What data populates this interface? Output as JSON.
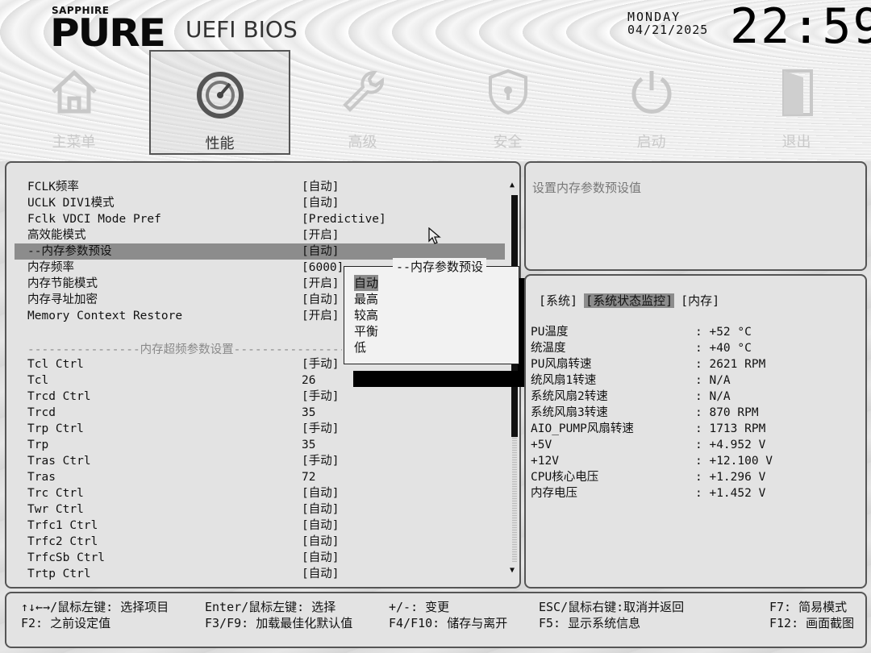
{
  "brand": {
    "small": "SAPPHIRE",
    "big": "PURE",
    "sub": "UEFI BIOS"
  },
  "clock": {
    "day": "MONDAY",
    "date": "04/21/2025",
    "time": "22:59"
  },
  "tabs": [
    {
      "label": "主菜单",
      "icon": "home-icon"
    },
    {
      "label": "性能",
      "icon": "gauge-icon"
    },
    {
      "label": "高级",
      "icon": "wrench-icon"
    },
    {
      "label": "安全",
      "icon": "shield-lock-icon"
    },
    {
      "label": "启动",
      "icon": "power-icon"
    },
    {
      "label": "退出",
      "icon": "exit-door-icon"
    }
  ],
  "settings": [
    {
      "label": "FCLK频率",
      "value": "[自动]"
    },
    {
      "label": "UCLK DIV1模式",
      "value": "[自动]"
    },
    {
      "label": "Fclk VDCI Mode Pref",
      "value": "[Predictive]"
    },
    {
      "label": "高效能模式",
      "value": "[开启]"
    },
    {
      "label": "--内存参数预设",
      "value": "[自动]"
    },
    {
      "label": "内存频率",
      "value": "[6000]"
    },
    {
      "label": "内存节能模式",
      "value": "[开启]"
    },
    {
      "label": "内存寻址加密",
      "value": "[自动]"
    },
    {
      "label": "Memory Context Restore",
      "value": "[开启]"
    },
    {
      "label": "Tcl Ctrl",
      "value": "[手动]"
    },
    {
      "label": "Tcl",
      "value": "26"
    },
    {
      "label": "Trcd Ctrl",
      "value": "[手动]"
    },
    {
      "label": "Trcd",
      "value": "35"
    },
    {
      "label": "Trp Ctrl",
      "value": "[手动]"
    },
    {
      "label": "Trp",
      "value": "35"
    },
    {
      "label": "Tras Ctrl",
      "value": "[手动]"
    },
    {
      "label": "Tras",
      "value": "72"
    },
    {
      "label": "Trc Ctrl",
      "value": "[自动]"
    },
    {
      "label": "Twr Ctrl",
      "value": "[自动]"
    },
    {
      "label": "Trfc1 Ctrl",
      "value": "[自动]"
    },
    {
      "label": "Trfc2 Ctrl",
      "value": "[自动]"
    },
    {
      "label": "TrfcSb Ctrl",
      "value": "[自动]"
    },
    {
      "label": "Trtp Ctrl",
      "value": "[自动]"
    }
  ],
  "section_separator": "----------------内存超频参数设置----------------",
  "popup": {
    "title": "--内存参数预设",
    "options": [
      "自动",
      "最高",
      "较高",
      "平衡",
      "低"
    ],
    "selected": "自动"
  },
  "help": {
    "text": "设置内存参数预设值"
  },
  "monitor": {
    "tabs": [
      "[系统]",
      "[系统状态监控]",
      "[内存]"
    ],
    "active_tab": "[系统状态监控]",
    "rows": [
      {
        "label": "PU温度",
        "value": ": +52 °C"
      },
      {
        "label": " 统温度",
        "value": ": +40 °C"
      },
      {
        "label": "PU风扇转速",
        "value": ": 2621 RPM"
      },
      {
        "label": " 统风扇1转速",
        "value": ": N/A"
      },
      {
        "label": "系统风扇2转速",
        "value": ": N/A"
      },
      {
        "label": "系统风扇3转速",
        "value": ": 870 RPM"
      },
      {
        "label": "AIO_PUMP风扇转速",
        "value": ": 1713 RPM"
      },
      {
        "label": "+5V",
        "value": ": +4.952 V"
      },
      {
        "label": "+12V",
        "value": ": +12.100 V"
      },
      {
        "label": "CPU核心电压",
        "value": ": +1.296 V"
      },
      {
        "label": "内存电压",
        "value": ": +1.452 V"
      }
    ]
  },
  "footer": {
    "h1": "↑↓←→/鼠标左键: 选择项目",
    "h2": "F2: 之前设定值",
    "h3": "Enter/鼠标左键: 选择",
    "h4": "F3/F9: 加载最佳化默认值",
    "h5": "+/-: 变更",
    "h6": "F4/F10: 储存与离开",
    "h7": "ESC/鼠标右键:取消并返回",
    "h8": "F5: 显示系统信息",
    "h9": "F7: 简易模式",
    "h10": "F12: 画面截图"
  }
}
